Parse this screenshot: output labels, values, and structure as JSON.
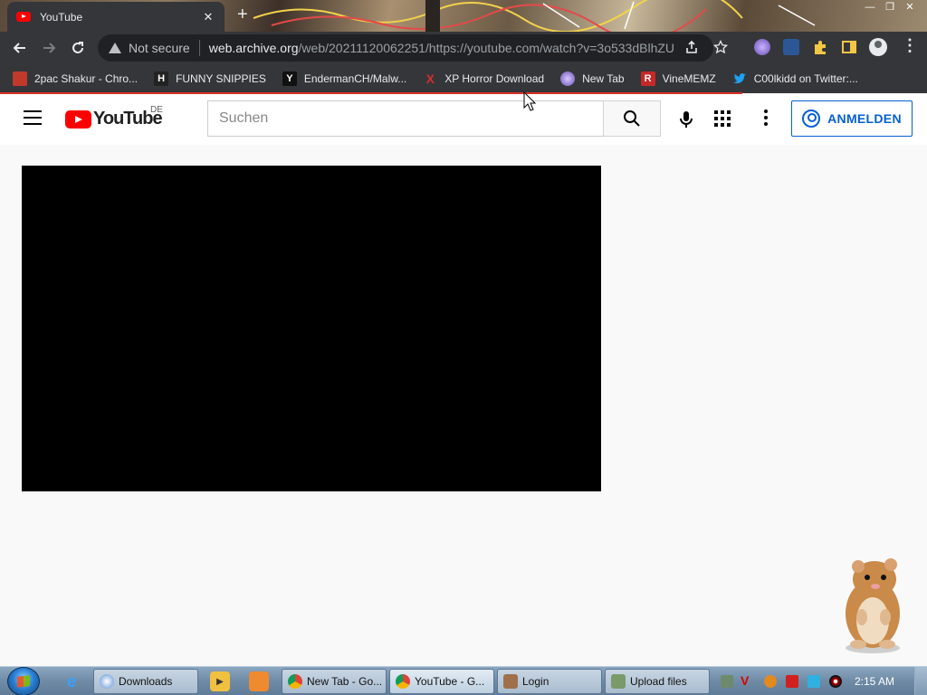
{
  "browser": {
    "tab_title": "YouTube",
    "tab_close": "✕",
    "new_tab": "+",
    "window_controls": [
      "—",
      "❐",
      "✕"
    ],
    "security_label": "Not secure",
    "url_host": "web.archive.org",
    "url_path": "/web/20211120062251/https://youtube.com/watch?v=3o533dBlhZU",
    "bookmarks": [
      {
        "label": "2pac Shakur - Chro...",
        "icon": "bookmark-favicon",
        "color": "#c0392b"
      },
      {
        "label": "FUNNY SNIPPIES",
        "icon": "h-favicon",
        "glyph": "H",
        "color": "#222222"
      },
      {
        "label": "EndermanCH/Malw...",
        "icon": "yp-favicon",
        "glyph": "Y",
        "color": "#111111"
      },
      {
        "label": "XP Horror Download",
        "icon": "x-favicon",
        "glyph": "X",
        "color": "#d32f2f"
      },
      {
        "label": "New Tab",
        "icon": "globe-favicon",
        "color": "#8e7cc3"
      },
      {
        "label": "VineMEMZ",
        "icon": "r-favicon",
        "glyph": "R",
        "color": "#c62828"
      },
      {
        "label": "C00lkidd on Twitter:...",
        "icon": "twitter-favicon",
        "color": "#1da1f2"
      }
    ]
  },
  "youtube": {
    "logo_text": "YouTube",
    "region": "DE",
    "search_placeholder": "Suchen",
    "signin_label": "ANMELDEN"
  },
  "taskbar": {
    "buttons": [
      {
        "label": "Downloads",
        "icon": "folder-icon"
      },
      {
        "label": "New Tab - Go...",
        "icon": "chrome-icon"
      },
      {
        "label": "YouTube - G...",
        "icon": "chrome-icon"
      },
      {
        "label": "Login",
        "icon": "app-icon"
      },
      {
        "label": "Upload files",
        "icon": "app-icon"
      }
    ],
    "clock": "2:15 AM"
  }
}
